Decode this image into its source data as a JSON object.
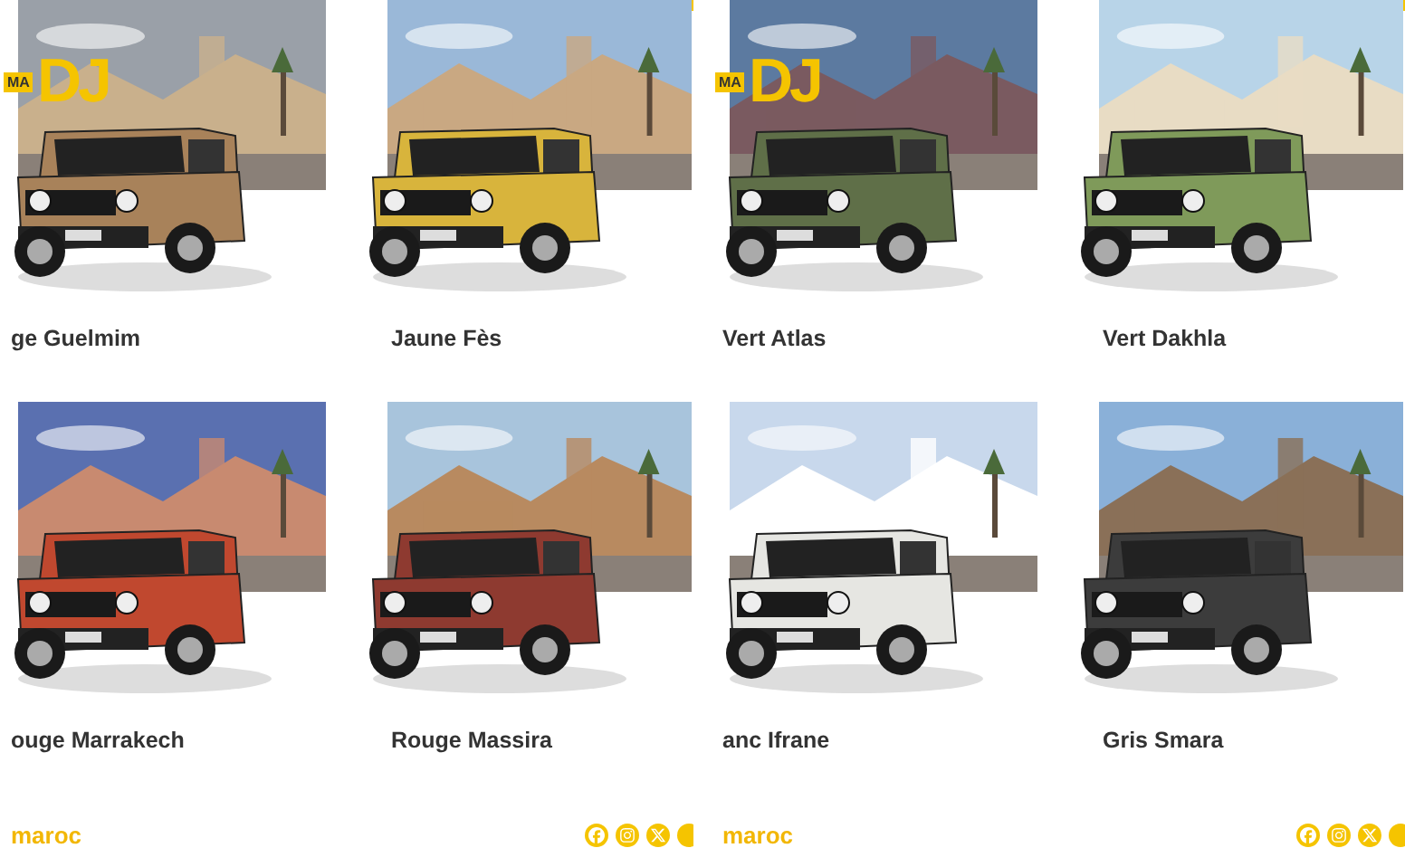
{
  "panels": [
    {
      "logo": {
        "mark": "DJ",
        "sub": "MA"
      },
      "cards": [
        {
          "label": "ge Guelmim",
          "color": "#a8825a"
        },
        {
          "label": "Jaune Fès",
          "color": "#d8b43c"
        },
        {
          "label": "ouge Marrakech",
          "color": "#c0482f"
        },
        {
          "label": "Rouge Massira",
          "color": "#8e3a30"
        }
      ],
      "footer": {
        "brand": "maroc"
      }
    },
    {
      "logo": {
        "mark": "DJ",
        "sub": "MA"
      },
      "cards": [
        {
          "label": "Vert Atlas",
          "color": "#5f6f48"
        },
        {
          "label": "Vert Dakhla",
          "color": "#7f9a5a"
        },
        {
          "label": "anc Ifrane",
          "color": "#e6e6e2"
        },
        {
          "label": "Gris Smara",
          "color": "#3c3c3c"
        }
      ],
      "footer": {
        "brand": "maroc"
      }
    }
  ]
}
